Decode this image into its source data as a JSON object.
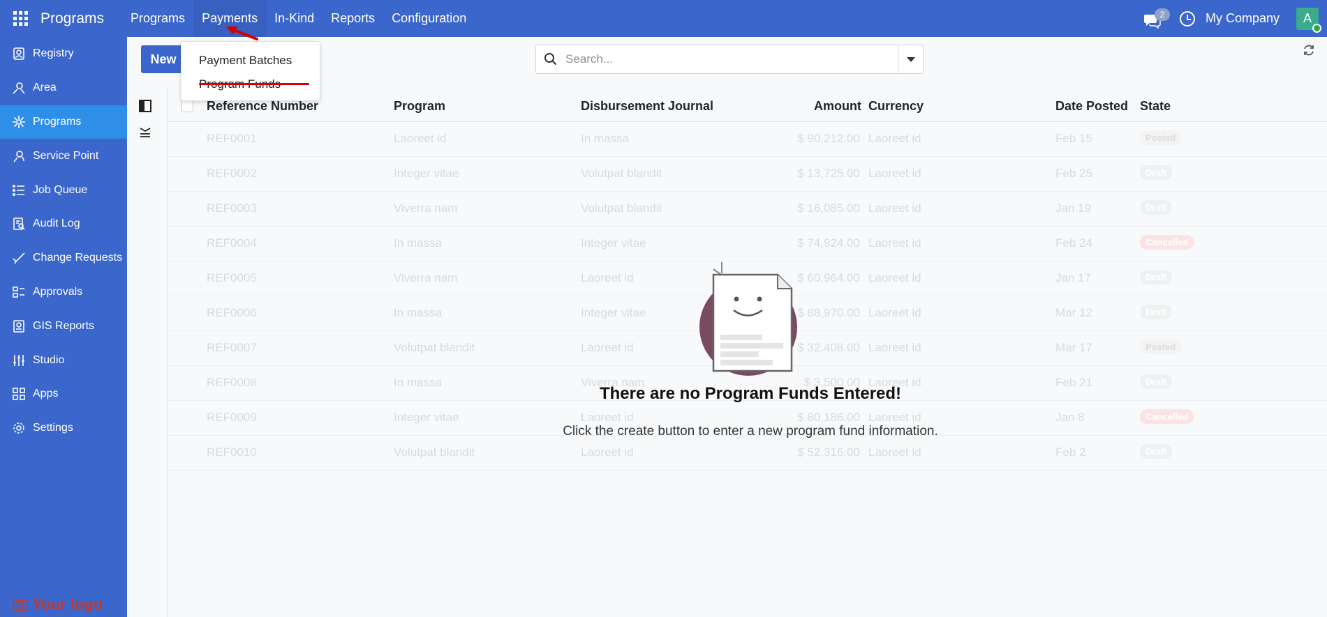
{
  "app": {
    "title": "Programs"
  },
  "topnav": {
    "items": [
      {
        "label": "Programs"
      },
      {
        "label": "Payments"
      },
      {
        "label": "In-Kind"
      },
      {
        "label": "Reports"
      },
      {
        "label": "Configuration"
      }
    ],
    "chat_count": "2",
    "company": "My Company",
    "avatar_letter": "A"
  },
  "sidebar": {
    "items": [
      {
        "label": "Registry",
        "icon": "registry-icon"
      },
      {
        "label": "Area",
        "icon": "area-icon"
      },
      {
        "label": "Programs",
        "icon": "programs-icon",
        "active": true
      },
      {
        "label": "Service Point",
        "icon": "service-point-icon"
      },
      {
        "label": "Job Queue",
        "icon": "job-queue-icon"
      },
      {
        "label": "Audit Log",
        "icon": "audit-log-icon"
      },
      {
        "label": "Change Requests",
        "icon": "change-requests-icon"
      },
      {
        "label": "Approvals",
        "icon": "approvals-icon"
      },
      {
        "label": "GIS Reports",
        "icon": "gis-reports-icon"
      },
      {
        "label": "Studio",
        "icon": "studio-icon"
      },
      {
        "label": "Apps",
        "icon": "apps-icon"
      },
      {
        "label": "Settings",
        "icon": "settings-icon"
      }
    ],
    "logo_text": "Your logo"
  },
  "control": {
    "new_label": "New",
    "search_placeholder": "Search..."
  },
  "dropdown": {
    "items": [
      {
        "label": "Payment Batches"
      },
      {
        "label": "Program Funds"
      }
    ]
  },
  "table": {
    "columns": {
      "ref": "Reference Number",
      "program": "Program",
      "journal": "Disbursement Journal",
      "amount": "Amount",
      "currency": "Currency",
      "date": "Date Posted",
      "state": "State"
    },
    "rows": [
      {
        "ref": "REF0001",
        "program": "Laoreet id",
        "journal": "In massa",
        "amount": "$ 90,212.00",
        "currency": "Laoreet id",
        "date": "Feb 15",
        "state": "Posted"
      },
      {
        "ref": "REF0002",
        "program": "Integer vitae",
        "journal": "Volutpat blandit",
        "amount": "$ 13,725.00",
        "currency": "Laoreet id",
        "date": "Feb 25",
        "state": "Draft"
      },
      {
        "ref": "REF0003",
        "program": "Viverra nam",
        "journal": "Volutpat blandit",
        "amount": "$ 16,085.00",
        "currency": "Laoreet id",
        "date": "Jan 19",
        "state": "Draft"
      },
      {
        "ref": "REF0004",
        "program": "In massa",
        "journal": "Integer vitae",
        "amount": "$ 74,924.00",
        "currency": "Laoreet id",
        "date": "Feb 24",
        "state": "Cancelled"
      },
      {
        "ref": "REF0005",
        "program": "Viverra nam",
        "journal": "Laoreet id",
        "amount": "$ 60,964.00",
        "currency": "Laoreet id",
        "date": "Jan 17",
        "state": "Draft"
      },
      {
        "ref": "REF0006",
        "program": "In massa",
        "journal": "Integer vitae",
        "amount": "$ 88,970.00",
        "currency": "Laoreet id",
        "date": "Mar 12",
        "state": "Draft"
      },
      {
        "ref": "REF0007",
        "program": "Volutpat blandit",
        "journal": "Laoreet id",
        "amount": "$ 32,408.00",
        "currency": "Laoreet id",
        "date": "Mar 17",
        "state": "Posted"
      },
      {
        "ref": "REF0008",
        "program": "In massa",
        "journal": "Viverra nam",
        "amount": "$ 3,500.00",
        "currency": "Laoreet id",
        "date": "Feb 21",
        "state": "Draft"
      },
      {
        "ref": "REF0009",
        "program": "Integer vitae",
        "journal": "Laoreet id",
        "amount": "$ 80,186.00",
        "currency": "Laoreet id",
        "date": "Jan 8",
        "state": "Cancelled"
      },
      {
        "ref": "REF0010",
        "program": "Volutpat blandit",
        "journal": "Laoreet id",
        "amount": "$ 52,316.00",
        "currency": "Laoreet id",
        "date": "Feb 2",
        "state": "Draft"
      }
    ]
  },
  "empty": {
    "title": "There are no Program Funds Entered!",
    "subtitle": "Click the create button to enter a new program fund information."
  },
  "colors": {
    "brand": "#3b66cc",
    "active_sidebar": "#2f8ee8",
    "annotation_red": "#d60000",
    "illustration_circle": "#7a4a63"
  }
}
